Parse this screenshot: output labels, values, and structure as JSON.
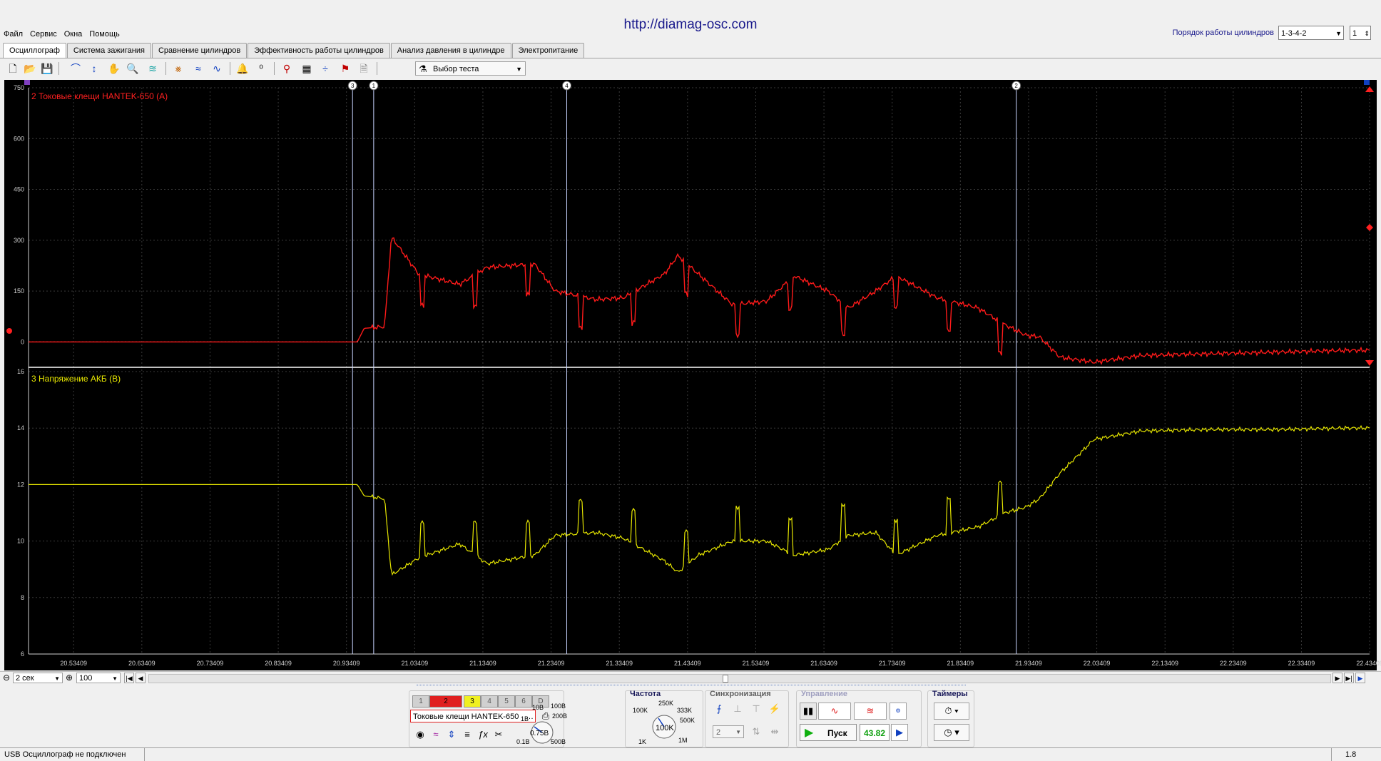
{
  "menu": [
    "Файл",
    "Сервис",
    "Окна",
    "Помощь"
  ],
  "header": {
    "url": "http://diamag-osc.com",
    "firing_order_label": "Порядок работы цилиндров",
    "firing_order_value": "1-3-4-2",
    "cylinder_value": "1"
  },
  "tabs": [
    {
      "label": "Осциллограф",
      "active": true
    },
    {
      "label": "Система зажигания"
    },
    {
      "label": "Сравнение цилиндров"
    },
    {
      "label": "Эффективность работы цилиндров"
    },
    {
      "label": "Анализ давления в цилиндре"
    },
    {
      "label": "Электропитание"
    }
  ],
  "toolbar": {
    "icons": [
      "new-file-icon",
      "open-folder-icon",
      "save-icon",
      "scale-curve-icon",
      "measure-icon",
      "hand-pan-icon",
      "zoom-icon",
      "channels-icon",
      "filter-icon",
      "overlay-icon",
      "waveform-icon",
      "bell-icon",
      "zero-icon",
      "cursor-filter-icon",
      "table-icon",
      "split-icon",
      "marker-flag-icon",
      "notes-icon"
    ],
    "test_select": "Выбор теста"
  },
  "scope": {
    "channel_top": {
      "label": "2 Токовые клещи HANTEK-650 (A)",
      "color": "#ff1a1a",
      "y_ticks": [
        "750",
        "600",
        "450",
        "300",
        "150",
        "0"
      ]
    },
    "channel_bottom": {
      "label": "3 Напряжение АКБ (В)",
      "color": "#e6e600",
      "y_ticks": [
        "16",
        "14",
        "12",
        "10",
        "8",
        "6"
      ]
    },
    "x_ticks": [
      "20.53409",
      "20.63409",
      "20.73409",
      "20.83409",
      "20.93409",
      "21.03409",
      "21.13409",
      "21.23409",
      "21.33409",
      "21.43409",
      "21.53409",
      "21.63409",
      "21.73409",
      "21.83409",
      "21.93409",
      "22.03409",
      "22.13409",
      "22.23409",
      "22.33409",
      "22.43409"
    ],
    "markers": [
      "3",
      "1",
      "4",
      "2"
    ],
    "marker_edge_left": "1",
    "marker_edge_right": "2"
  },
  "chart_data": [
    {
      "type": "line",
      "title": "2 Токовые клещи HANTEK-650 (A)",
      "ylim": [
        -75,
        750
      ],
      "x": [
        20.5,
        20.95,
        20.96,
        20.99,
        21.0,
        21.04,
        21.1,
        21.14,
        21.21,
        21.24,
        21.3,
        21.34,
        21.4,
        21.42,
        21.45,
        21.5,
        21.55,
        21.59,
        21.64,
        21.67,
        21.71,
        21.74,
        21.8,
        21.86,
        21.9,
        21.93,
        21.95,
        21.98,
        22.03,
        22.1,
        22.2,
        22.3,
        22.4,
        22.44
      ],
      "y": [
        0,
        0,
        40,
        45,
        310,
        200,
        170,
        220,
        230,
        150,
        125,
        130,
        200,
        255,
        200,
        110,
        120,
        195,
        150,
        100,
        150,
        195,
        130,
        100,
        50,
        20,
        15,
        -45,
        -60,
        -40,
        -35,
        -30,
        -25,
        -25
      ]
    },
    {
      "type": "line",
      "title": "3 Напряжение АКБ (В)",
      "ylim": [
        6,
        16
      ],
      "x": [
        20.5,
        20.95,
        20.96,
        20.99,
        21.0,
        21.04,
        21.1,
        21.14,
        21.21,
        21.24,
        21.3,
        21.34,
        21.4,
        21.42,
        21.45,
        21.5,
        21.55,
        21.59,
        21.64,
        21.67,
        21.71,
        21.74,
        21.8,
        21.86,
        21.9,
        21.93,
        21.95,
        21.98,
        22.03,
        22.1,
        22.2,
        22.3,
        22.4,
        22.44
      ],
      "y": [
        12.0,
        12.0,
        11.6,
        11.5,
        8.8,
        9.4,
        9.9,
        9.2,
        9.5,
        10.2,
        10.3,
        10.1,
        9.3,
        8.9,
        9.5,
        10.0,
        10.0,
        9.5,
        9.7,
        10.2,
        10.3,
        9.5,
        10.2,
        10.5,
        11.0,
        11.2,
        11.5,
        12.4,
        13.6,
        13.9,
        13.95,
        13.95,
        14.0,
        14.0
      ]
    }
  ],
  "nav": {
    "time_div": "2 сек",
    "zoom": "100"
  },
  "panel": {
    "channels": [
      "1",
      "2",
      "3",
      "4",
      "5",
      "6",
      "D"
    ],
    "probe_name": "Токовые клещи HANTEK-650",
    "amp_knob": {
      "value": "0.75B",
      "labels": [
        "10B",
        "100B",
        "1B",
        "200B",
        "0.1B",
        "500B"
      ]
    },
    "freq_title": "Частота",
    "freq_knob": {
      "value": "100K",
      "labels": [
        "250K",
        "100K",
        "333K",
        "500K",
        "1K",
        "1M"
      ]
    },
    "sync_title": "Синхронизация",
    "sync_value": "2",
    "control_title": "Управление",
    "run_label": "Пуск",
    "fps_value": "43.82",
    "timers_title": "Таймеры"
  },
  "status": {
    "connection": "USB Осциллограф не подключен",
    "version": "1.8"
  }
}
